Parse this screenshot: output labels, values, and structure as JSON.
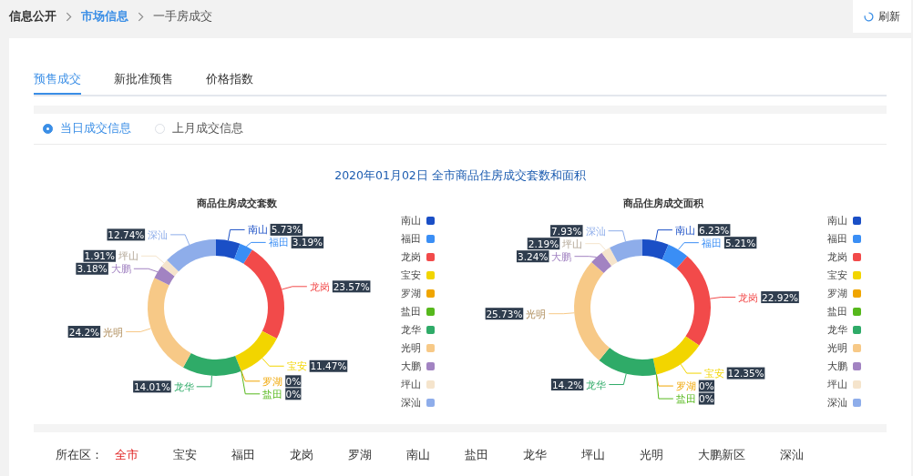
{
  "breadcrumb": [
    {
      "label": "信息公开",
      "kind": "root"
    },
    {
      "label": "市场信息",
      "kind": "link"
    },
    {
      "label": "一手房成交",
      "kind": "current"
    }
  ],
  "refresh_button": {
    "label": "刷新"
  },
  "tabs": [
    {
      "label": "预售成交",
      "selected": true
    },
    {
      "label": "新批准预售",
      "selected": false
    },
    {
      "label": "价格指数",
      "selected": false
    }
  ],
  "period_options": [
    {
      "label": "当日成交信息",
      "selected": true
    },
    {
      "label": "上月成交信息",
      "selected": false
    }
  ],
  "headline": "2020年01月02日 全市商品住房成交套数和面积",
  "charts": [
    {
      "chart_data": {
        "type": "donut",
        "title": "商品住房成交套数",
        "categories": [
          "南山",
          "福田",
          "龙岗",
          "宝安",
          "罗湖",
          "盐田",
          "龙华",
          "光明",
          "大鹏",
          "坪山",
          "深汕"
        ],
        "series": [
          {
            "colors": [
              "#1a4fc6",
              "#3a8ef5",
              "#f24a4a",
              "#f2d500",
              "#f0a500",
              "#56b81c",
              "#2fab68",
              "#f7c987",
              "#a283c2",
              "#f5e4cc",
              "#8eadea"
            ],
            "values": [
              5.73,
              3.19,
              23.57,
              11.47,
              0,
              0,
              14.01,
              24.2,
              3.18,
              1.91,
              12.74
            ]
          }
        ],
        "value_labels": [
          "5.73%",
          "3.19%",
          "23.57%",
          "11.47%",
          "0%",
          "0%",
          "14.01%",
          "24.2%",
          "3.18%",
          "1.91%",
          "12.74%"
        ]
      }
    },
    {
      "chart_data": {
        "type": "donut",
        "title": "商品住房成交面积",
        "categories": [
          "南山",
          "福田",
          "龙岗",
          "宝安",
          "罗湖",
          "盐田",
          "龙华",
          "光明",
          "大鹏",
          "坪山",
          "深汕"
        ],
        "series": [
          {
            "colors": [
              "#1a4fc6",
              "#3a8ef5",
              "#f24a4a",
              "#f2d500",
              "#f0a500",
              "#56b81c",
              "#2fab68",
              "#f7c987",
              "#a283c2",
              "#f5e4cc",
              "#8eadea"
            ],
            "values": [
              6.23,
              5.21,
              22.92,
              12.35,
              0,
              0,
              14.2,
              25.73,
              3.24,
              2.19,
              7.93
            ]
          }
        ],
        "value_labels": [
          "6.23%",
          "5.21%",
          "22.92%",
          "12.35%",
          "0%",
          "0%",
          "14.2%",
          "25.73%",
          "3.24%",
          "2.19%",
          "7.93%"
        ]
      }
    }
  ],
  "district_filter": {
    "label": "所在区：",
    "options": [
      {
        "label": "全市",
        "selected": true
      },
      {
        "label": "宝安",
        "selected": false
      },
      {
        "label": "福田",
        "selected": false
      },
      {
        "label": "龙岗",
        "selected": false
      },
      {
        "label": "罗湖",
        "selected": false
      },
      {
        "label": "南山",
        "selected": false
      },
      {
        "label": "盐田",
        "selected": false
      },
      {
        "label": "龙华",
        "selected": false
      },
      {
        "label": "坪山",
        "selected": false
      },
      {
        "label": "光明",
        "selected": false
      },
      {
        "label": "大鹏新区",
        "selected": false
      },
      {
        "label": "深汕",
        "selected": false
      }
    ]
  }
}
